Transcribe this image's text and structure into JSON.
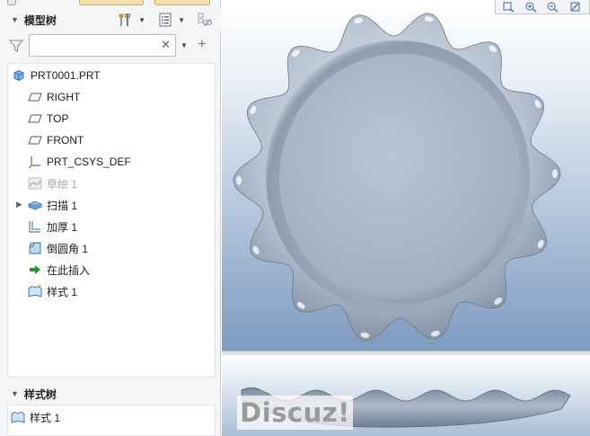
{
  "model_tree": {
    "title": "模型树",
    "search_value": "",
    "items": [
      {
        "label": "PRT0001.PRT",
        "icon": "part-icon",
        "dim": false
      },
      {
        "label": "RIGHT",
        "icon": "datum-plane-icon",
        "dim": false
      },
      {
        "label": "TOP",
        "icon": "datum-plane-icon",
        "dim": false
      },
      {
        "label": "FRONT",
        "icon": "datum-plane-icon",
        "dim": false
      },
      {
        "label": "PRT_CSYS_DEF",
        "icon": "coordinate-system-icon",
        "dim": false
      },
      {
        "label": "草绘 1",
        "icon": "sketch-icon",
        "dim": true
      },
      {
        "label": "扫描 1",
        "icon": "sweep-icon",
        "dim": false
      },
      {
        "label": "加厚 1",
        "icon": "thicken-icon",
        "dim": false
      },
      {
        "label": "倒圆角 1",
        "icon": "round-icon",
        "dim": false
      },
      {
        "label": "在此插入",
        "icon": "insert-here-arrow-icon",
        "dim": false
      },
      {
        "label": "样式 1",
        "icon": "style-surface-icon",
        "dim": false
      }
    ]
  },
  "style_tree": {
    "title": "样式树",
    "items": [
      {
        "label": "样式 1",
        "icon": "style-surface-icon"
      }
    ]
  },
  "viewport": {
    "background_top": "#ffffff",
    "background_bottom": "#7d9bc1",
    "model_color": "#a9b6c6",
    "toolbar_icons": [
      "zoom-fit-icon",
      "zoom-in-icon",
      "zoom-out-icon",
      "repaint-icon"
    ]
  },
  "watermark": {
    "text": "Discuz!"
  }
}
